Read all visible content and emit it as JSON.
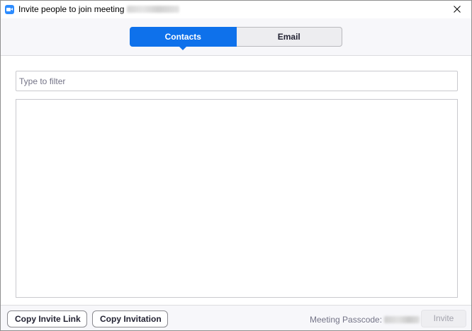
{
  "window": {
    "title": "Invite people to join meeting",
    "meeting_id_redacted": true,
    "app_icon": "zoom-camera-icon",
    "close_icon": "close-icon"
  },
  "tabs": [
    {
      "label": "Contacts",
      "active": true
    },
    {
      "label": "Email",
      "active": false
    }
  ],
  "filter": {
    "placeholder": "Type to filter",
    "value": ""
  },
  "contacts": {
    "items": []
  },
  "footer": {
    "copy_invite_link_label": "Copy Invite Link",
    "copy_invitation_label": "Copy Invitation",
    "passcode_label": "Meeting Passcode:",
    "passcode_redacted": true,
    "invite_label": "Invite",
    "invite_enabled": false
  },
  "colors": {
    "accent": "#0e71eb",
    "app_icon": "#2d8cff"
  }
}
